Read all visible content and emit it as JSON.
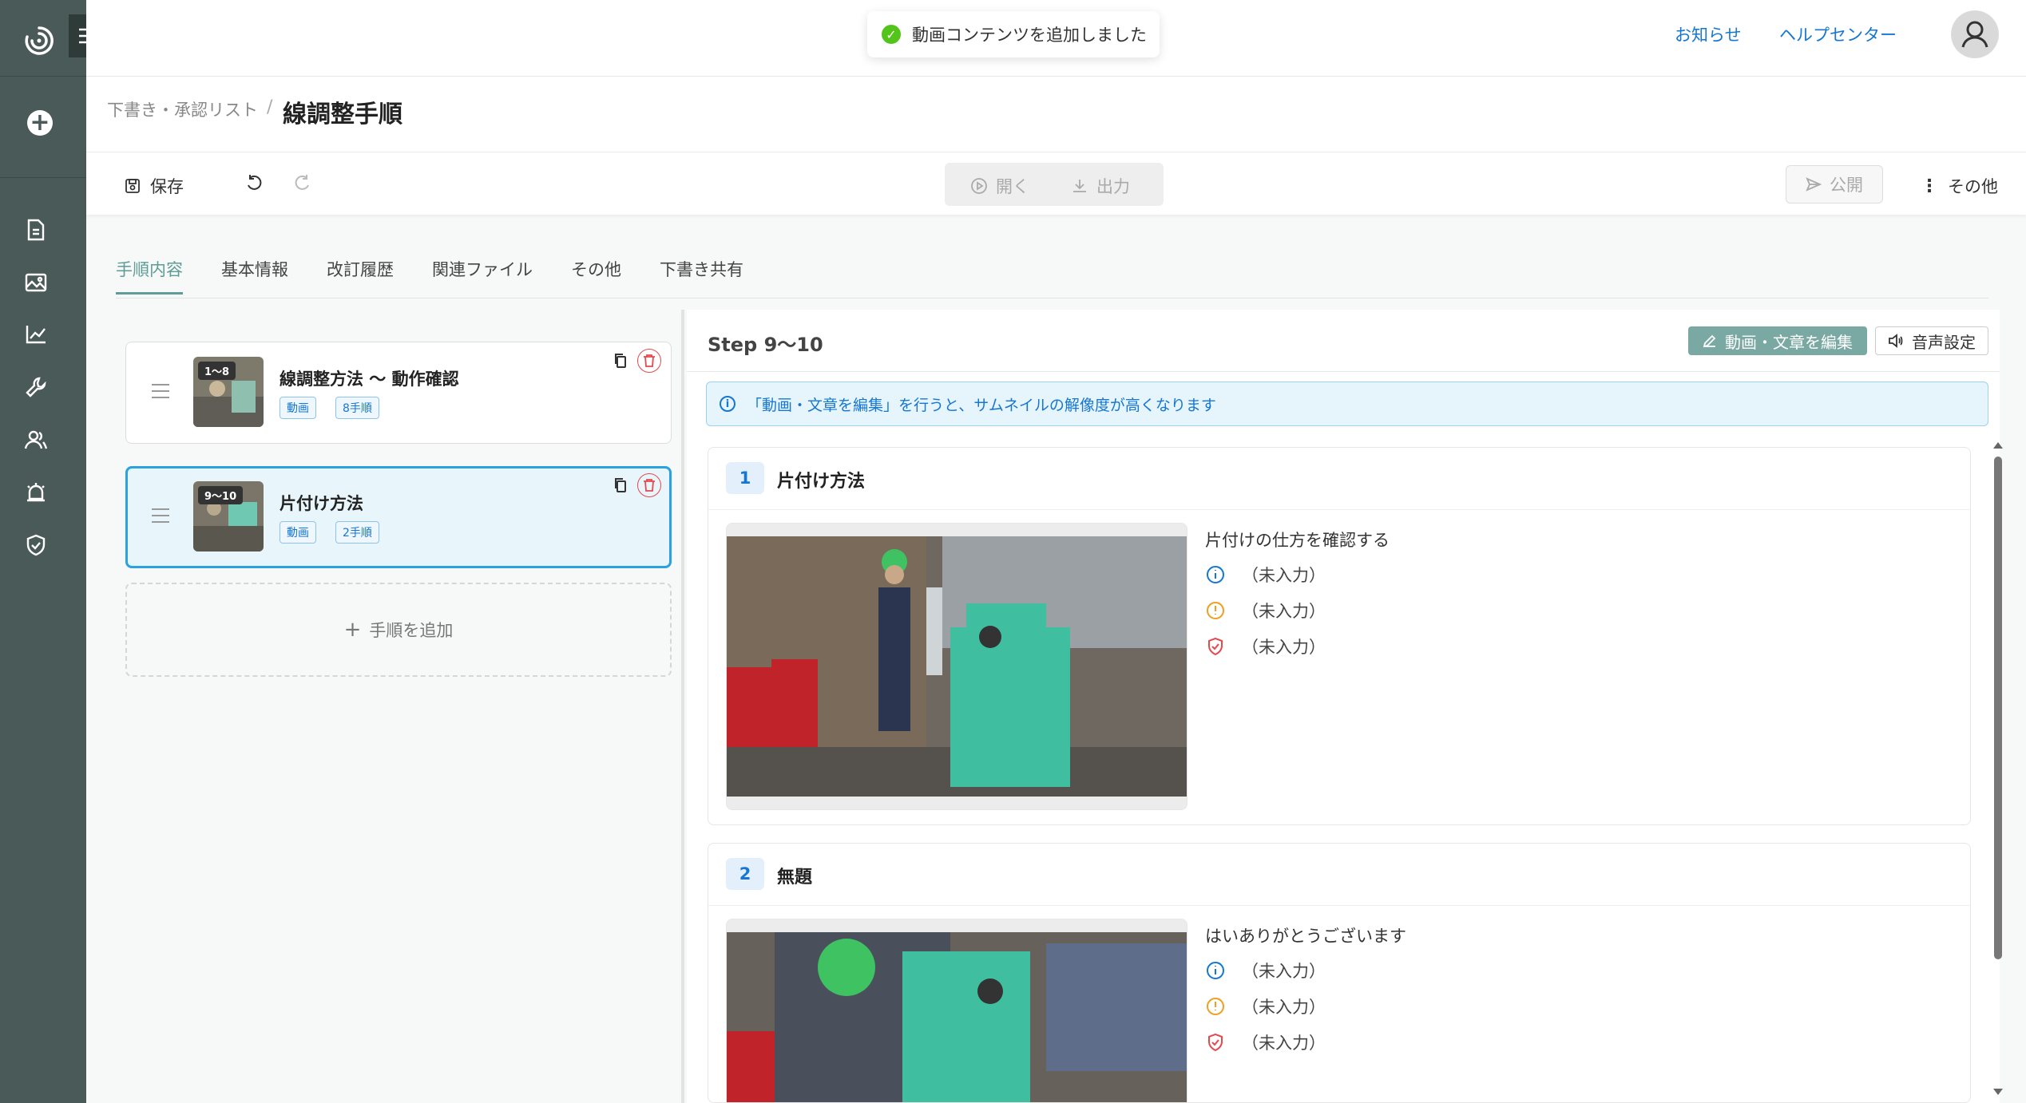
{
  "toast": {
    "message": "動画コンテンツを追加しました"
  },
  "header": {
    "links": [
      "お知らせ",
      "ヘルプセンター"
    ]
  },
  "breadcrumb": {
    "parent": "下書き・承認リスト",
    "separator": "/",
    "title": "線調整手順"
  },
  "toolbar": {
    "save": "保存",
    "open": "開く",
    "export": "出力",
    "publish": "公開",
    "more": "その他"
  },
  "tabs": [
    "手順内容",
    "基本情報",
    "改訂履歴",
    "関連ファイル",
    "その他",
    "下書き共有"
  ],
  "cards": [
    {
      "range": "1～8",
      "title": "線調整方法 〜 動作確認",
      "tag_type": "動画",
      "tag_count": "8手順"
    },
    {
      "range": "9～10",
      "title": "片付け方法",
      "tag_type": "動画",
      "tag_count": "2手順"
    }
  ],
  "add_step": "手順を追加",
  "right": {
    "title": "Step 9〜10",
    "edit_button": "動画・文章を編集",
    "audio_button": "音声設定",
    "banner": "「動画・文章を編集」を行うと、サムネイルの解像度が高くなります",
    "steps": [
      {
        "num": "1",
        "title": "片付け方法",
        "text": "片付けの仕方を確認する",
        "note1": "（未入力）",
        "note2": "（未入力）",
        "note3": "（未入力）"
      },
      {
        "num": "2",
        "title": "無題",
        "text": "はいありがとうございます",
        "note1": "（未入力）",
        "note2": "（未入力）",
        "note3": "（未入力）"
      }
    ]
  },
  "colors": {
    "sidebar": "#4a5a58",
    "accent": "#5e9d97",
    "link": "#1677d2",
    "selected_border": "#2aa1e0",
    "danger": "#e5484d"
  }
}
